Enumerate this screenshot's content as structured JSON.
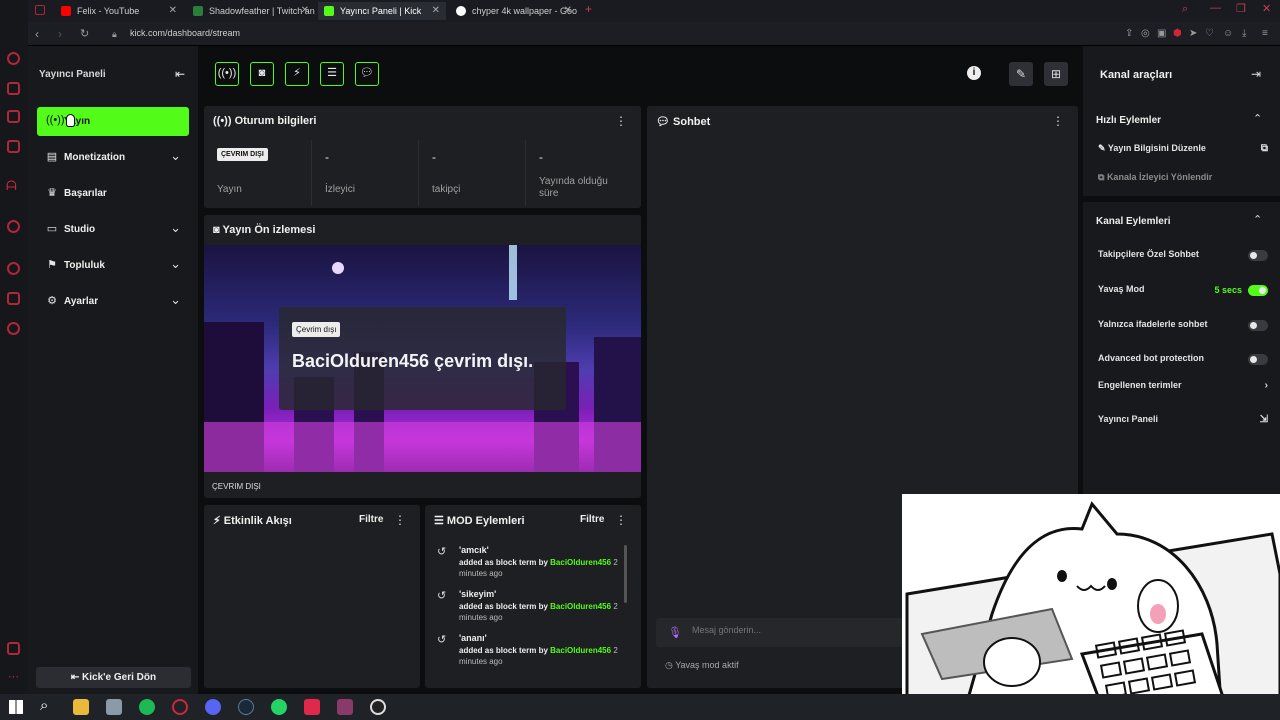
{
  "browser": {
    "tabs": [
      {
        "title": "Felix - YouTube",
        "favicon": "youtube-icon",
        "color": "#ff0000"
      },
      {
        "title": "Shadowfeather | Twitch an",
        "favicon": "shield-icon",
        "color": "#53fc18"
      },
      {
        "title": "Yayıncı Paneli | Kick",
        "favicon": "kick-icon",
        "color": "#53fc18",
        "active": true
      },
      {
        "title": "chyper 4k wallpaper - Goo",
        "favicon": "google-icon",
        "color": "#4285f4"
      }
    ],
    "new_tab": "+",
    "url": "kick.com/dashboard/stream"
  },
  "left_nav": {
    "title": "Yayıncı Paneli",
    "items": [
      {
        "label": "Yayın",
        "icon": "broadcast-icon",
        "active": true
      },
      {
        "label": "Monetization",
        "icon": "money-icon",
        "expandable": true
      },
      {
        "label": "Başarılar",
        "icon": "trophy-icon"
      },
      {
        "label": "Studio",
        "icon": "studio-icon",
        "expandable": true
      },
      {
        "label": "Topluluk",
        "icon": "community-icon",
        "expandable": true
      },
      {
        "label": "Ayarlar",
        "icon": "gear-icon",
        "expandable": true
      }
    ],
    "back_button": "Kick'e Geri Dön"
  },
  "session": {
    "title": "Oturum bilgileri",
    "status_badge": "ÇEVRIM DIŞI",
    "stats": [
      {
        "value": "",
        "label": "Yayın"
      },
      {
        "value": "-",
        "label": "İzleyici"
      },
      {
        "value": "-",
        "label": "takipçi"
      },
      {
        "value": "-",
        "label": "Yayında olduğu süre"
      }
    ]
  },
  "preview": {
    "title": "Yayın Ön izlemesi",
    "badge": "Çevrim dışı",
    "message": "BaciOlduren456 çevrim dışı.",
    "footer": "ÇEVRIM DIŞI"
  },
  "activity": {
    "title": "Etkinlik Akışı",
    "filter": "Filtre"
  },
  "mod_actions": {
    "title": "MOD Eylemleri",
    "filter": "Filtre",
    "entries": [
      {
        "term": "'amcık'",
        "action": "added as block term by",
        "user": "BaciOlduren456",
        "time": "2 minutes ago"
      },
      {
        "term": "'sikeyim'",
        "action": "added as block term by",
        "user": "BaciOlduren456",
        "time": "2 minutes ago"
      },
      {
        "term": "'ananı'",
        "action": "added as block term by",
        "user": "BaciOlduren456",
        "time": "2 minutes ago"
      }
    ]
  },
  "chat": {
    "title": "Sohbet",
    "placeholder": "Mesaj gönderin...",
    "slow_mode_notice": "Yavaş mod aktif"
  },
  "channel_tools": {
    "title": "Kanal araçları",
    "quick_actions": {
      "title": "Hızlı Eylemler",
      "items": [
        "Yayın Bilgisini Düzenle",
        "Kanala İzleyici Yönlendir"
      ]
    },
    "channel_actions": {
      "title": "Kanal Eylemleri",
      "items": [
        {
          "label": "Takipçilere Özel Sohbet",
          "toggle": false
        },
        {
          "label": "Yavaş Mod",
          "toggle": true,
          "value": "5 secs"
        },
        {
          "label": "Yalnızca ifadelerle sohbet",
          "toggle": false
        },
        {
          "label": "Advanced bot protection",
          "toggle": false
        },
        {
          "label": "Engellenen terimler"
        },
        {
          "label": "Yayıncı Paneli"
        }
      ]
    }
  },
  "colors": {
    "accent": "#53fc18",
    "bg": "#0c0d0f",
    "panel": "#1e1f22"
  }
}
